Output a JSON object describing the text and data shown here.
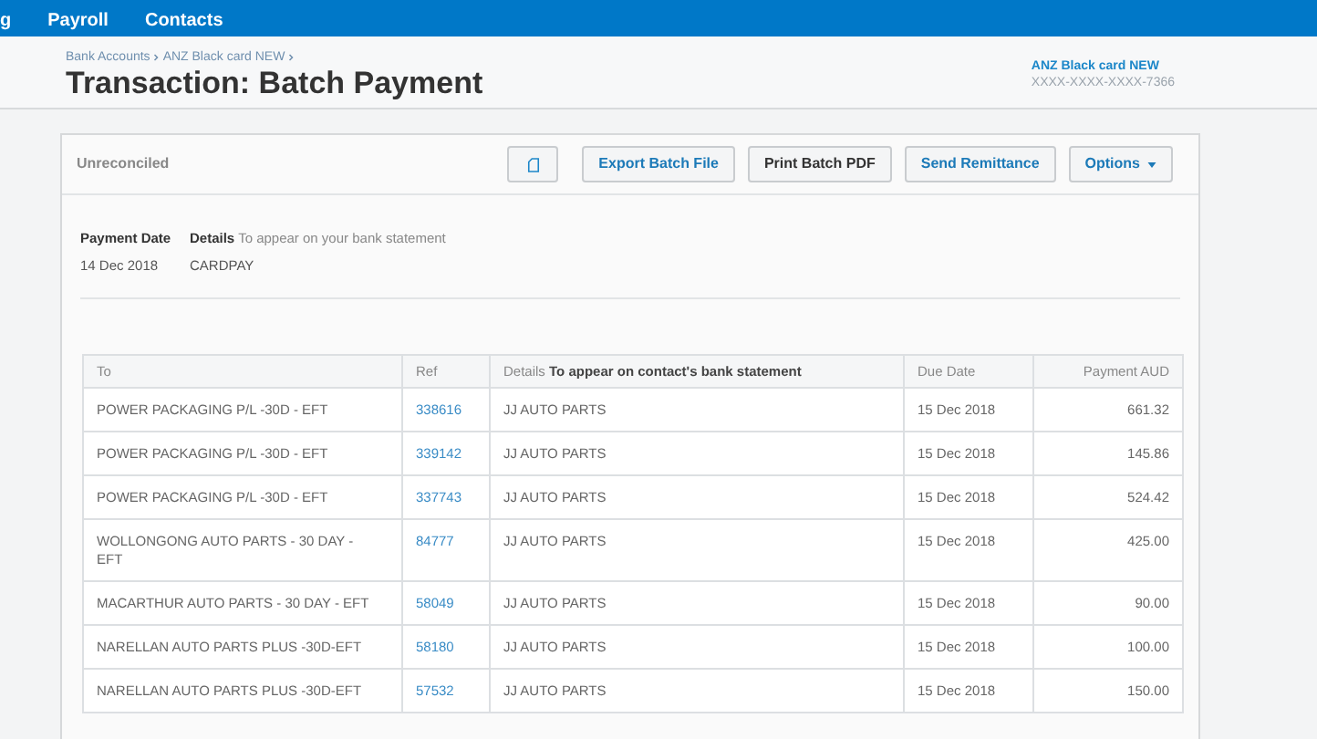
{
  "nav": {
    "items": [
      "g",
      "Payroll",
      "Contacts"
    ]
  },
  "header": {
    "breadcrumb": [
      "Bank Accounts",
      "ANZ Black card NEW"
    ],
    "title": "Transaction: Batch Payment",
    "account_name": "ANZ Black card NEW",
    "account_number": "XXXX-XXXX-XXXX-7366"
  },
  "toolbar": {
    "status": "Unreconciled",
    "buttons": [
      {
        "kind": "icon"
      },
      {
        "kind": "text",
        "label": "Export Batch File"
      },
      {
        "kind": "text",
        "label": "Print Batch PDF"
      },
      {
        "kind": "text",
        "label": "Send Remittance"
      },
      {
        "kind": "dropdown",
        "label": "Options"
      }
    ]
  },
  "payment": {
    "date_label": "Payment Date",
    "details_label": "Details",
    "details_hint": "To appear on your bank statement",
    "date": "14 Dec 2018",
    "details": "CARDPAY"
  },
  "table": {
    "columns": [
      {
        "label": "To"
      },
      {
        "label": "Ref"
      },
      {
        "label": "Details",
        "hint": "To appear on contact's bank statement"
      },
      {
        "label": "Due Date"
      },
      {
        "label": "Payment AUD"
      }
    ],
    "rows": [
      {
        "to": "POWER PACKAGING P/L -30D - EFT",
        "ref": "338616",
        "details": "JJ AUTO PARTS",
        "due": "15 Dec 2018",
        "amount": "661.32"
      },
      {
        "to": "POWER PACKAGING P/L -30D - EFT",
        "ref": "339142",
        "details": "JJ AUTO PARTS",
        "due": "15 Dec 2018",
        "amount": "145.86"
      },
      {
        "to": "POWER PACKAGING P/L -30D - EFT",
        "ref": "337743",
        "details": "JJ AUTO PARTS",
        "due": "15 Dec 2018",
        "amount": "524.42"
      },
      {
        "to": "WOLLONGONG AUTO PARTS - 30 DAY - EFT",
        "ref": "84777",
        "details": "JJ AUTO PARTS",
        "due": "15 Dec 2018",
        "amount": "425.00"
      },
      {
        "to": "MACARTHUR AUTO PARTS - 30 DAY - EFT",
        "ref": "58049",
        "details": "JJ AUTO PARTS",
        "due": "15 Dec 2018",
        "amount": "90.00"
      },
      {
        "to": "NARELLAN AUTO PARTS PLUS -30D-EFT",
        "ref": "58180",
        "details": "JJ AUTO PARTS",
        "due": "15 Dec 2018",
        "amount": "100.00"
      },
      {
        "to": "NARELLAN AUTO PARTS PLUS -30D-EFT",
        "ref": "57532",
        "details": "JJ AUTO PARTS",
        "due": "15 Dec 2018",
        "amount": "150.00"
      }
    ]
  }
}
